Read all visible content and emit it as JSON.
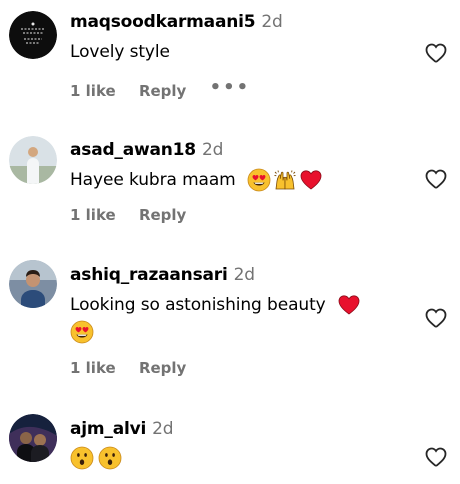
{
  "comments": [
    {
      "username": "maqsoodkarmaani5",
      "time": "2d",
      "text": "Lovely style",
      "likes": "1 like",
      "reply": "Reply",
      "more": "•••",
      "avatar_colors": [
        "#0b0b0b",
        "#1b1b1b"
      ]
    },
    {
      "username": "asad_awan18",
      "time": "2d",
      "text": "Hayee kubra maam",
      "emojis": [
        "heart-eyes",
        "raised-hands",
        "red-heart"
      ],
      "likes": "1 like",
      "reply": "Reply",
      "avatar_colors": [
        "#c9d4dc",
        "#e8ecef"
      ]
    },
    {
      "username": "ashiq_razaansari",
      "time": "2d",
      "text": "Looking so astonishing beauty",
      "emojis": [
        "red-heart",
        "heart-eyes"
      ],
      "likes": "1 like",
      "reply": "Reply",
      "avatar_colors": [
        "#4a5f7a",
        "#9aa7b8"
      ]
    },
    {
      "username": "ajm_alvi",
      "time": "2d",
      "emojis": [
        "astonished",
        "astonished"
      ],
      "avatar_colors": [
        "#1b2a4a",
        "#5a3e6d"
      ]
    }
  ],
  "colors": {
    "secondary_text": "#737373",
    "heart_emoji": "#e8112d",
    "emoji_face": "#f8c12d"
  }
}
